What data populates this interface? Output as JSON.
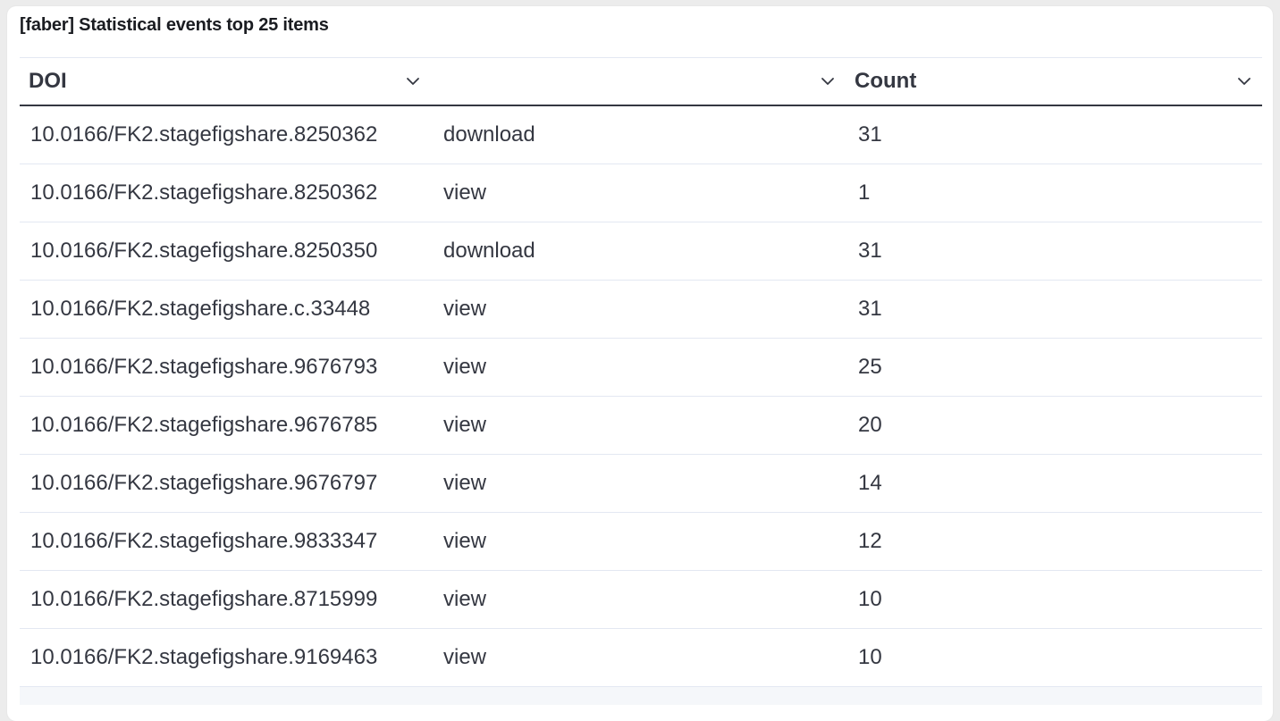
{
  "panel": {
    "title": "[faber] Statistical events top 25 items"
  },
  "table": {
    "columns": [
      {
        "label": "DOI"
      },
      {
        "label": ""
      },
      {
        "label": "Count"
      }
    ],
    "rows": [
      {
        "doi": "10.0166/FK2.stagefigshare.8250362",
        "event": "download",
        "count": "31"
      },
      {
        "doi": "10.0166/FK2.stagefigshare.8250362",
        "event": "view",
        "count": "1"
      },
      {
        "doi": "10.0166/FK2.stagefigshare.8250350",
        "event": "download",
        "count": "31"
      },
      {
        "doi": "10.0166/FK2.stagefigshare.c.33448",
        "event": "view",
        "count": "31"
      },
      {
        "doi": "10.0166/FK2.stagefigshare.9676793",
        "event": "view",
        "count": "25"
      },
      {
        "doi": "10.0166/FK2.stagefigshare.9676785",
        "event": "view",
        "count": "20"
      },
      {
        "doi": "10.0166/FK2.stagefigshare.9676797",
        "event": "view",
        "count": "14"
      },
      {
        "doi": "10.0166/FK2.stagefigshare.9833347",
        "event": "view",
        "count": "12"
      },
      {
        "doi": "10.0166/FK2.stagefigshare.8715999",
        "event": "view",
        "count": "10"
      },
      {
        "doi": "10.0166/FK2.stagefigshare.9169463",
        "event": "view",
        "count": "10"
      }
    ]
  },
  "icons": {
    "column_menu": "chevron-down-icon"
  },
  "colors": {
    "text": "#343741",
    "title": "#1a1c21",
    "header_rule": "#343741",
    "row_rule": "#e3e8f2"
  }
}
